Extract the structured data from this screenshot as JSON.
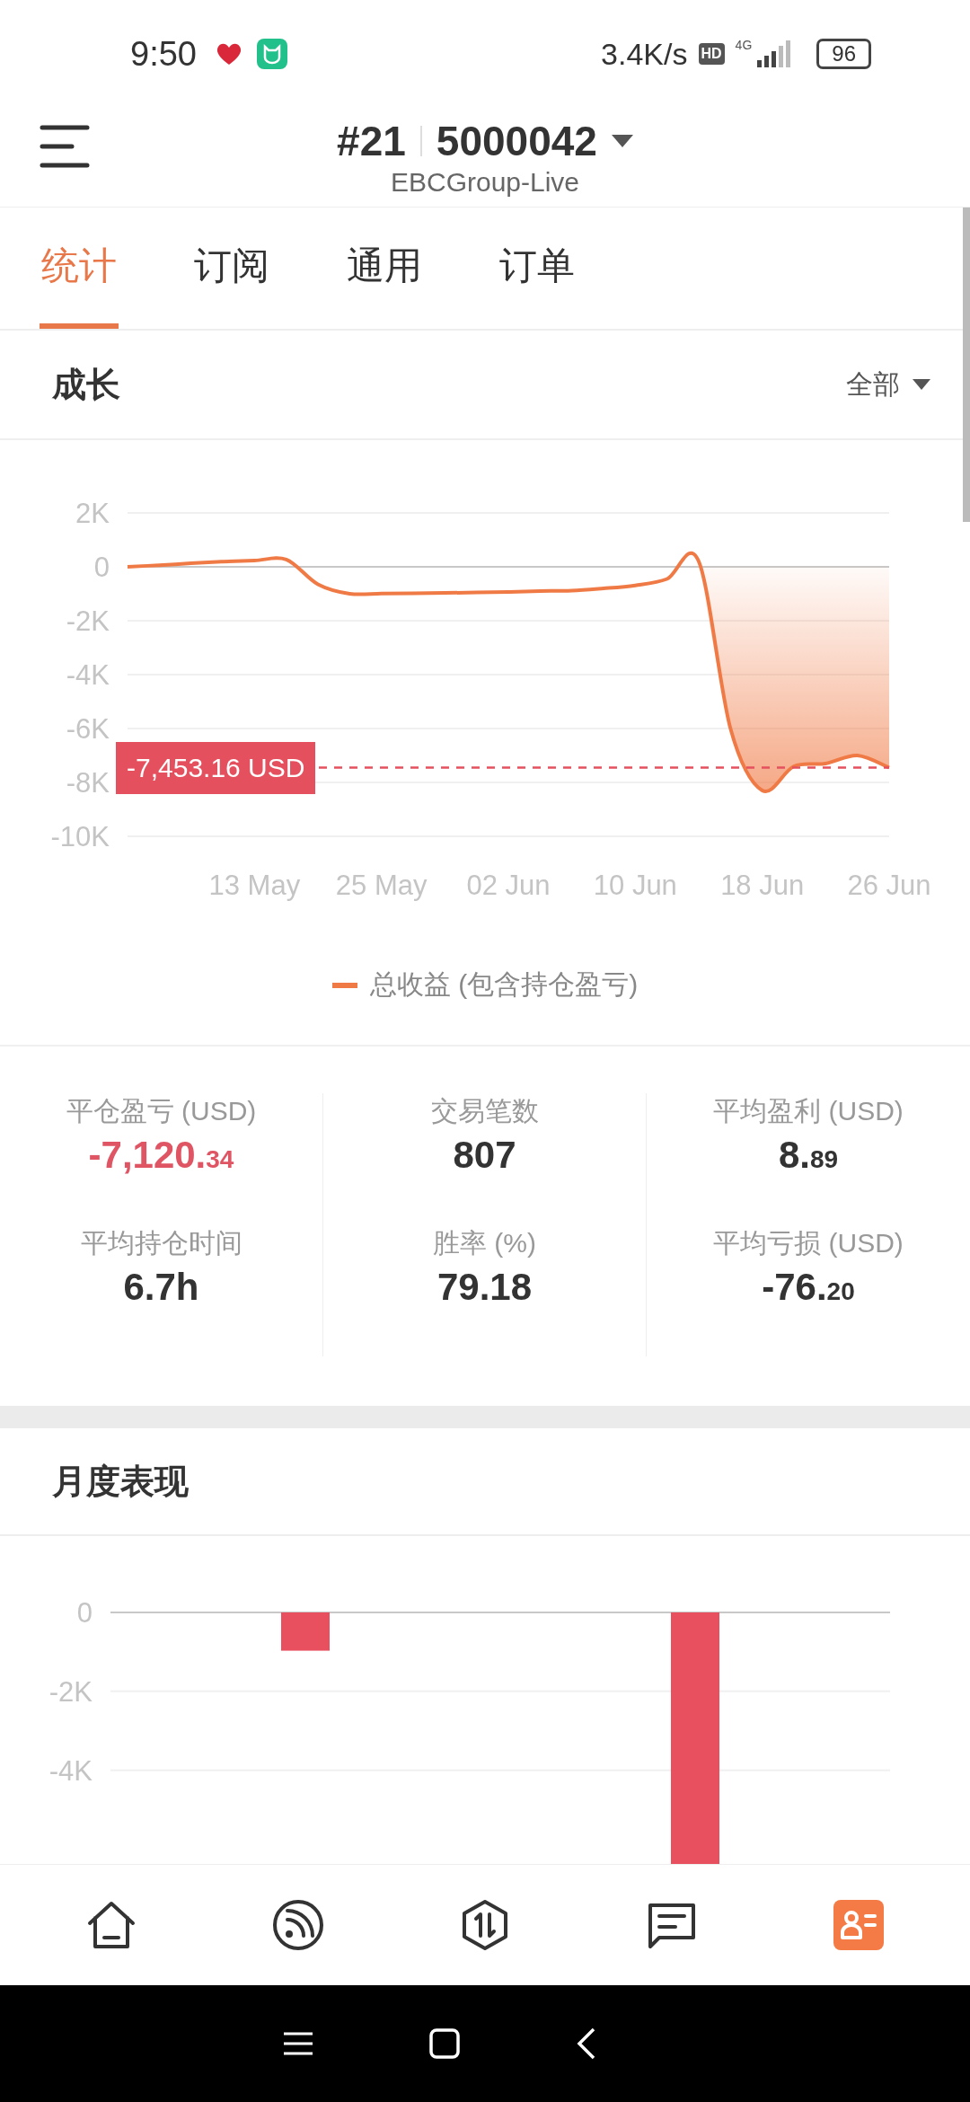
{
  "status_bar": {
    "time": "9:50",
    "speed": "3.4K/s",
    "hd": "HD",
    "network": "4G",
    "battery": "96"
  },
  "header": {
    "account_index": "#21",
    "account": "5000042",
    "server": "EBCGroup-Live"
  },
  "tabs": [
    {
      "label": "统计",
      "selected": true
    },
    {
      "label": "订阅",
      "selected": false
    },
    {
      "label": "通用",
      "selected": false
    },
    {
      "label": "订单",
      "selected": false
    }
  ],
  "growth": {
    "title": "成长",
    "filter": "全部",
    "chart_data": {
      "type": "line",
      "categories": [
        null,
        null,
        null,
        null,
        "13 May",
        null,
        null,
        null,
        "25 May",
        null,
        null,
        null,
        "02 Jun",
        null,
        null,
        null,
        "10 Jun",
        null,
        null,
        null,
        "18 Jun",
        null,
        null,
        null,
        "26 Jun"
      ],
      "series": [
        {
          "name": "总收益 (包含持仓盈亏)",
          "color": "#f07a45",
          "values": [
            0,
            60,
            130,
            190,
            230,
            270,
            -650,
            -1000,
            -990,
            -980,
            -970,
            -950,
            -930,
            -900,
            -880,
            -800,
            -690,
            -450,
            200,
            -6000,
            -8300,
            -7400,
            -7300,
            -7000,
            -7450
          ]
        }
      ],
      "ylim": [
        -10000,
        2000
      ],
      "grid": true,
      "yticks": [
        {
          "value": 2000,
          "label": "2K"
        },
        {
          "value": 0,
          "label": "0"
        },
        {
          "value": -2000,
          "label": "-2K"
        },
        {
          "value": -4000,
          "label": "-4K"
        },
        {
          "value": -6000,
          "label": "-6K"
        },
        {
          "value": -8000,
          "label": "-8K"
        },
        {
          "value": -10000,
          "label": "-10K"
        }
      ]
    },
    "current_value": "-7,453.16 USD"
  },
  "stats": [
    {
      "label": "平仓盈亏 (USD)",
      "value": "-7,120.",
      "fraction": "34",
      "highlighted": true
    },
    {
      "label": "交易笔数",
      "value": "807",
      "highlighted": false
    },
    {
      "label": "平均盈利 (USD)",
      "value": "8.",
      "fraction": "89",
      "highlighted": false
    },
    {
      "label": "平均持仓时间",
      "value": "6.7h",
      "highlighted": false
    },
    {
      "label": "胜率 (%)",
      "value": "79.18",
      "highlighted": false
    },
    {
      "label": "平均亏损 (USD)",
      "value": "-76.",
      "fraction": "20",
      "highlighted": false
    }
  ],
  "monthly": {
    "title": "月度表现",
    "chart_data": {
      "type": "bar",
      "series": [
        {
          "color": "#e8505f",
          "values": [
            -970,
            -6400
          ]
        }
      ],
      "ylim": [
        -6400,
        0
      ],
      "grid": true,
      "yticks": [
        {
          "value": 0,
          "label": "0"
        },
        {
          "value": -2000,
          "label": "-2K"
        },
        {
          "value": -4000,
          "label": "-4K"
        }
      ]
    }
  },
  "bottom_nav": [
    {
      "selected": false
    },
    {
      "selected": false
    },
    {
      "selected": false
    },
    {
      "selected": false
    },
    {
      "selected": true
    }
  ]
}
